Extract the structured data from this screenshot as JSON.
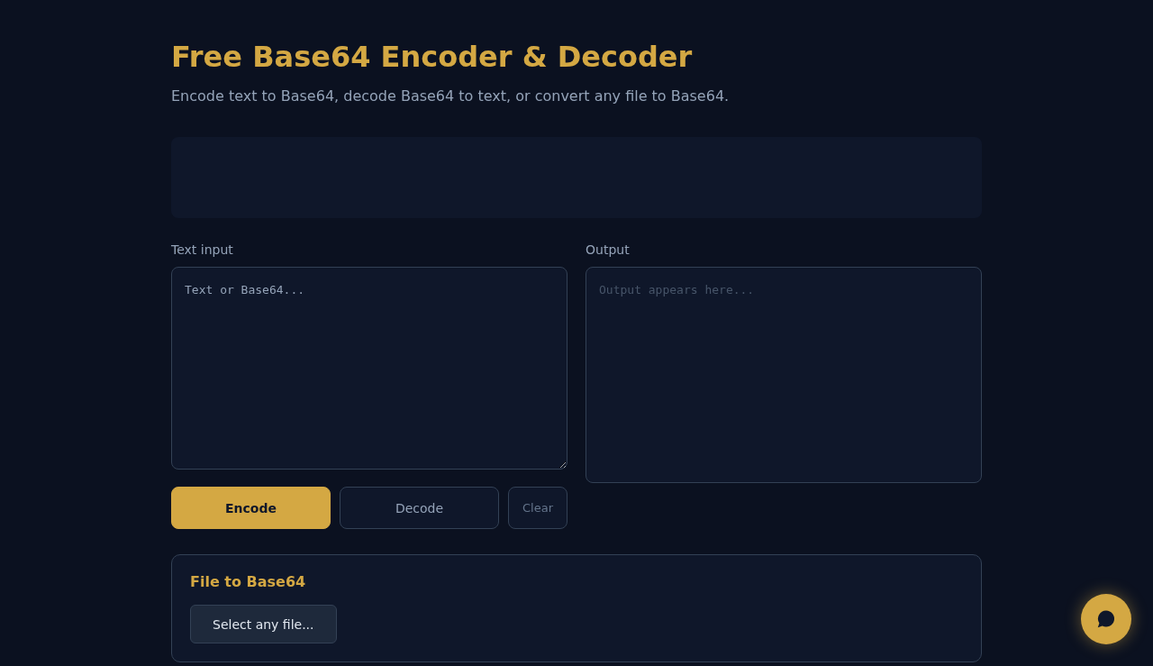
{
  "header": {
    "title": "Free Base64 Encoder & Decoder",
    "subtitle": "Encode text to Base64, decode Base64 to text, or convert any file to Base64."
  },
  "converter": {
    "input": {
      "label": "Text input",
      "placeholder": "Text or Base64..."
    },
    "output": {
      "label": "Output",
      "placeholder": "Output appears here..."
    },
    "buttons": [
      {
        "label": "Encode",
        "kind": "primary"
      },
      {
        "label": "Decode",
        "kind": "secondary"
      },
      {
        "label": "Clear",
        "kind": "tertiary"
      }
    ]
  },
  "file_section": {
    "title": "File to Base64",
    "button": "Select any file..."
  }
}
